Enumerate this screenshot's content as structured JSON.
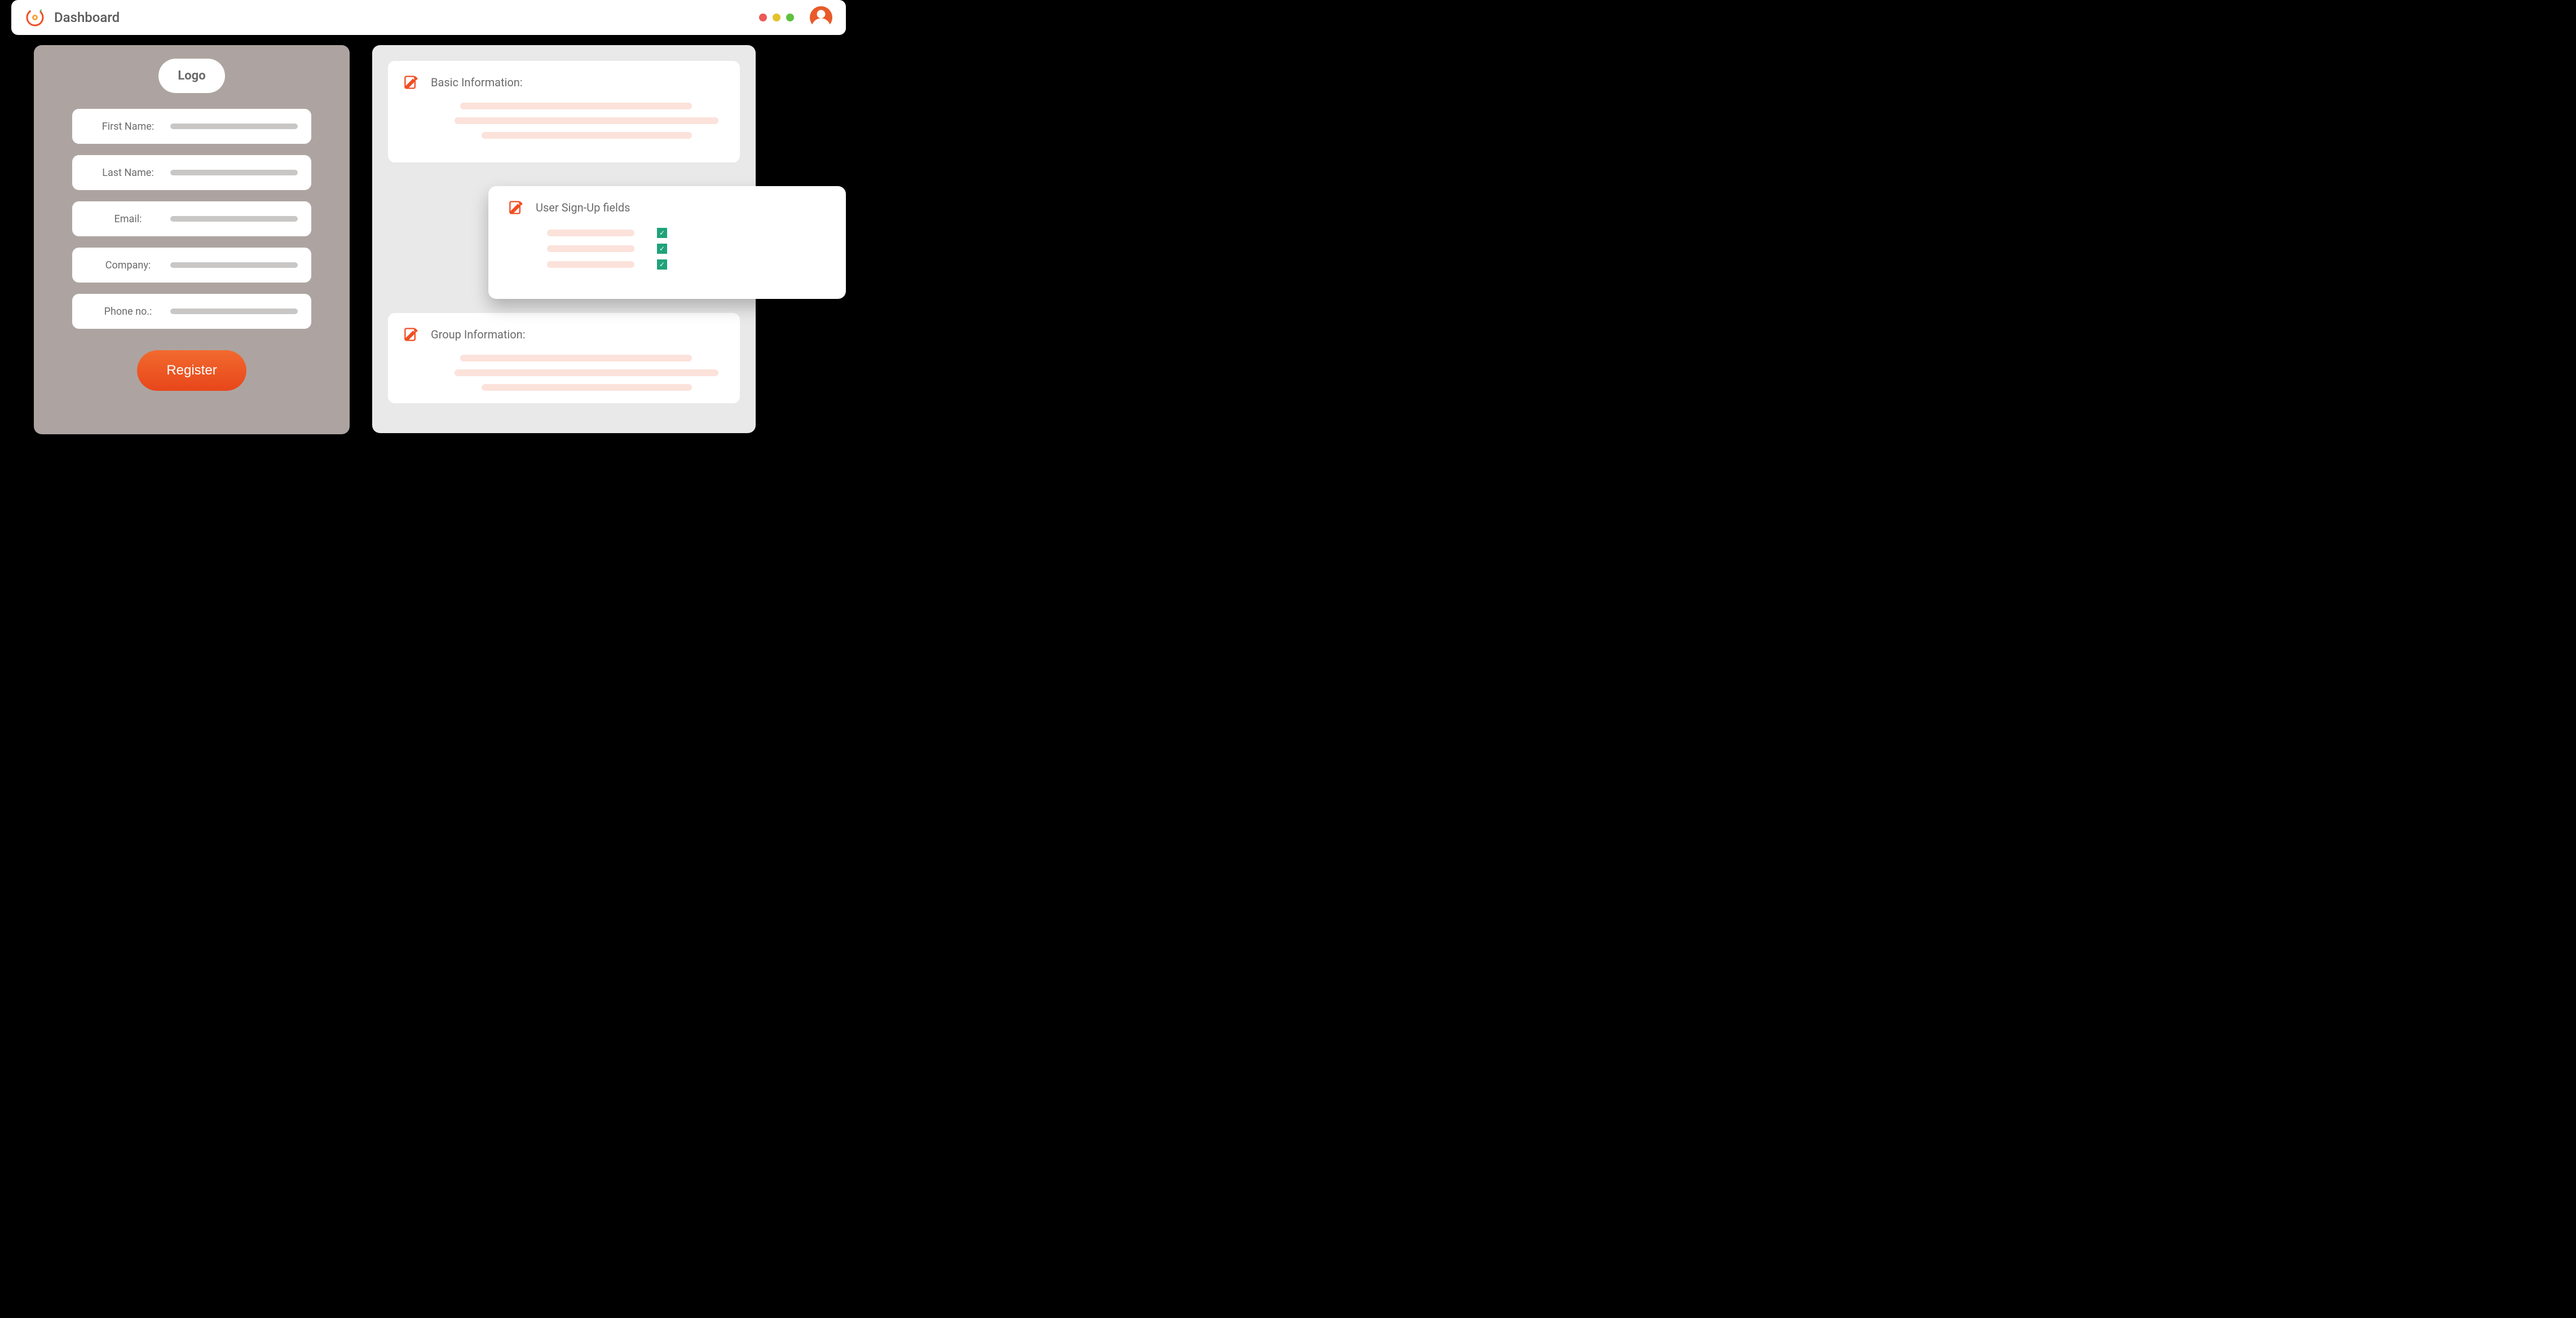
{
  "header": {
    "title": "Dashboard"
  },
  "form": {
    "logo_label": "Logo",
    "fields": [
      {
        "label": "First Name:"
      },
      {
        "label": "Last Name:"
      },
      {
        "label": "Email:"
      },
      {
        "label": "Company:"
      },
      {
        "label": "Phone no.:"
      }
    ],
    "register_label": "Register"
  },
  "sections": {
    "basic_title": "Basic Information:",
    "signup_title": "User Sign-Up fields",
    "group_title": "Group Information:"
  },
  "signup_checks": [
    {
      "checked": true
    },
    {
      "checked": true
    },
    {
      "checked": true
    }
  ],
  "colors": {
    "accent": "#f04e23",
    "check": "#1fa37a"
  }
}
